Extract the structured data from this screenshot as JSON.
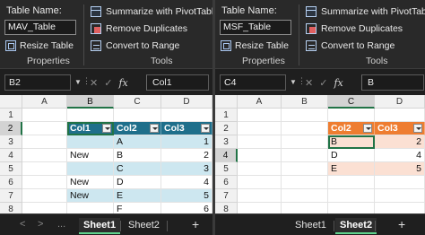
{
  "left": {
    "ribbon": {
      "table_name_label": "Table Name:",
      "table_name_value": "MAV_Table",
      "resize_label": "Resize Table",
      "properties_group": "Properties",
      "summarize_label": "Summarize with PivotTable",
      "remove_dup_label": "Remove Duplicates",
      "convert_label": "Convert to Range",
      "tools_group": "Tools"
    },
    "formula": {
      "namebox": "B2",
      "value": "Col1"
    },
    "columns": [
      "A",
      "B",
      "C",
      "D"
    ],
    "rows": [
      "1",
      "2",
      "3",
      "4",
      "5",
      "6",
      "7",
      "8"
    ],
    "table": {
      "headers": [
        "Col1",
        "Col2",
        "Col3"
      ],
      "rows": [
        [
          "",
          "A",
          "1"
        ],
        [
          "New",
          "B",
          "2"
        ],
        [
          "",
          "C",
          "3"
        ],
        [
          "New",
          "D",
          "4"
        ],
        [
          "New",
          "E",
          "5"
        ],
        [
          "",
          "F",
          "6"
        ]
      ]
    },
    "tabs": {
      "sheet1": "Sheet1",
      "sheet2": "Sheet2",
      "add": "+",
      "prev": "<",
      "next": ">",
      "more": "..."
    }
  },
  "right": {
    "ribbon": {
      "table_name_label": "Table Name:",
      "table_name_value": "MSF_Table",
      "resize_label": "Resize Table",
      "properties_group": "Properties",
      "summarize_label": "Summarize with PivotTable",
      "remove_dup_label": "Remove Duplicates",
      "convert_label": "Convert to Range",
      "tools_group": "Tools"
    },
    "formula": {
      "namebox": "C4",
      "value": "B"
    },
    "columns": [
      "A",
      "B",
      "C",
      "D"
    ],
    "rows": [
      "1",
      "2",
      "3",
      "4",
      "5",
      "6",
      "7",
      "8"
    ],
    "table": {
      "headers": [
        "Col2",
        "Col3"
      ],
      "rows": [
        [
          "B",
          "2"
        ],
        [
          "D",
          "4"
        ],
        [
          "E",
          "5"
        ]
      ]
    },
    "tabs": {
      "sheet1": "Sheet1",
      "sheet2": "Sheet2",
      "add": "+"
    }
  },
  "colors": {
    "left_header": "#1f6f8b",
    "left_band": "#cde7f0",
    "right_header": "#ee7d31",
    "right_band": "#fbe0d3",
    "selection": "#217346"
  }
}
